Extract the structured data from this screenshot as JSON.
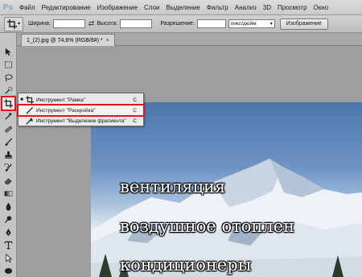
{
  "app": {
    "logo": "Ps",
    "menu": [
      "Файл",
      "Редактирование",
      "Изображение",
      "Слои",
      "Выделение",
      "Фильтр",
      "Анализ",
      "3D",
      "Просмотр",
      "Окно"
    ]
  },
  "options_bar": {
    "width_label": "Ширина:",
    "height_label": "Высота:",
    "resolution_label": "Разрешение:",
    "units_value": "пикс/дюйм",
    "image_button": "Изображение",
    "width_value": "",
    "height_value": "",
    "resolution_value": ""
  },
  "document": {
    "tab_title": "1_(2).jpg @ 74,6% (RGB/8#) *",
    "close_glyph": "×"
  },
  "flyout": {
    "items": [
      {
        "label": "Инструмент \"Рамка\"",
        "shortcut": "C",
        "bullet": "■"
      },
      {
        "label": "Инструмент \"Раскройка\"",
        "shortcut": "C",
        "bullet": ""
      },
      {
        "label": "Инструмент \"Выделение фрагмента\"",
        "shortcut": "C",
        "bullet": ""
      }
    ]
  },
  "canvas_text": {
    "line1": "вентиляция",
    "line2": "воздушное отоплен",
    "line3": "кондиционеры"
  },
  "colors": {
    "highlight_red": "#e0161d",
    "sky_blue": "#4d76ac"
  },
  "icons": [
    "move-icon",
    "marquee-icon",
    "lasso-icon",
    "quick-select-icon",
    "crop-icon",
    "eyedropper-icon",
    "healing-icon",
    "brush-icon",
    "stamp-icon",
    "history-brush-icon",
    "eraser-icon",
    "gradient-icon",
    "blur-icon",
    "dodge-icon",
    "pen-icon",
    "type-icon",
    "path-select-icon",
    "shape-icon"
  ]
}
